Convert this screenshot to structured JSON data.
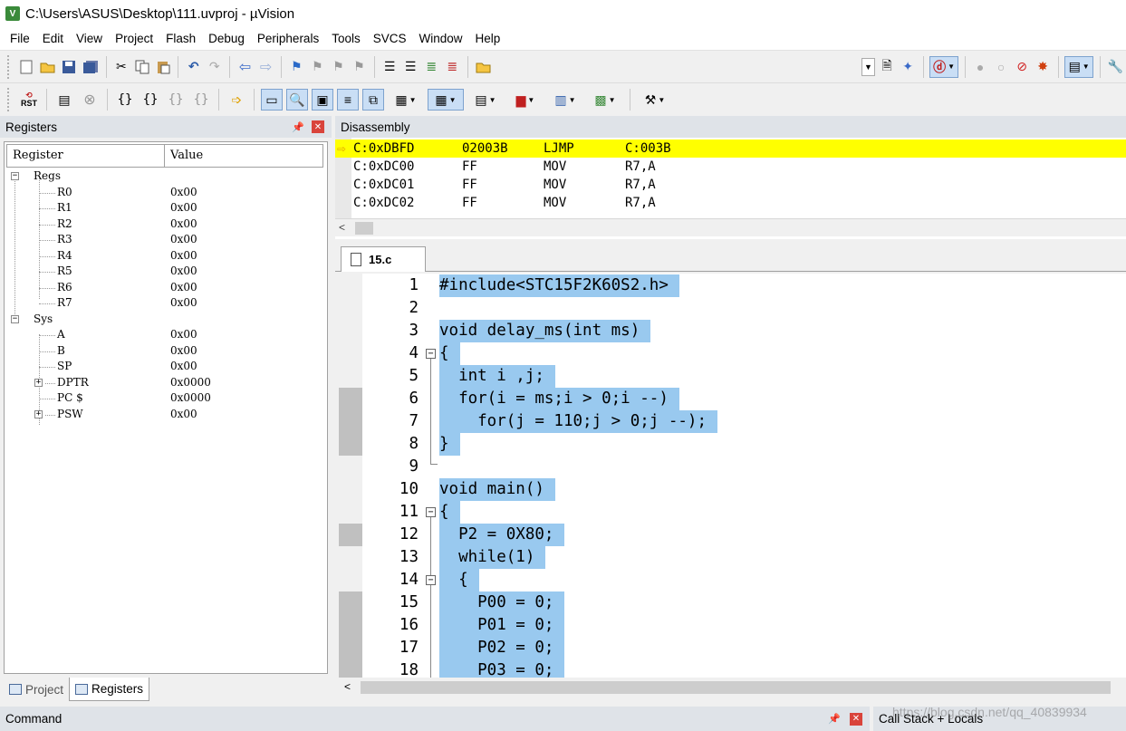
{
  "window": {
    "title": "C:\\Users\\ASUS\\Desktop\\111.uvproj - µVision",
    "icon": "uvision-app-icon"
  },
  "menu": [
    "File",
    "Edit",
    "View",
    "Project",
    "Flash",
    "Debug",
    "Peripherals",
    "Tools",
    "SVCS",
    "Window",
    "Help"
  ],
  "toolbar": {
    "reset_label": "RST"
  },
  "registers_panel": {
    "title": "Registers",
    "columns": [
      "Register",
      "Value"
    ],
    "rows": [
      {
        "name": "Regs",
        "value": ""
      },
      {
        "name": "R0",
        "value": "0x00"
      },
      {
        "name": "R1",
        "value": "0x00"
      },
      {
        "name": "R2",
        "value": "0x00"
      },
      {
        "name": "R3",
        "value": "0x00"
      },
      {
        "name": "R4",
        "value": "0x00"
      },
      {
        "name": "R5",
        "value": "0x00"
      },
      {
        "name": "R6",
        "value": "0x00"
      },
      {
        "name": "R7",
        "value": "0x00"
      },
      {
        "name": "Sys",
        "value": ""
      },
      {
        "name": "A",
        "value": "0x00"
      },
      {
        "name": "B",
        "value": "0x00"
      },
      {
        "name": "SP",
        "value": "0x00"
      },
      {
        "name": "DPTR",
        "value": "0x0000"
      },
      {
        "name": "PC $",
        "value": "0x0000"
      },
      {
        "name": "PSW",
        "value": "0x00"
      }
    ],
    "tabs": [
      "Project",
      "Registers"
    ]
  },
  "disassembly": {
    "title": "Disassembly",
    "lines": [
      {
        "addr": "C:0xDBFD",
        "opcode": "02003B",
        "mnemonic": "LJMP",
        "operand": "C:003B"
      },
      {
        "addr": "C:0xDC00",
        "opcode": "FF",
        "mnemonic": "MOV",
        "operand": "R7,A"
      },
      {
        "addr": "C:0xDC01",
        "opcode": "FF",
        "mnemonic": "MOV",
        "operand": "R7,A"
      },
      {
        "addr": "C:0xDC02",
        "opcode": "FF",
        "mnemonic": "MOV",
        "operand": "R7,A"
      }
    ]
  },
  "editor": {
    "tab": "15.c",
    "lines": [
      {
        "n": "1",
        "text": "#include<STC15F2K60S2.h>"
      },
      {
        "n": "2",
        "text": ""
      },
      {
        "n": "3",
        "text": "void delay_ms(int ms)"
      },
      {
        "n": "4",
        "text": "{"
      },
      {
        "n": "5",
        "text": "  int i ,j;"
      },
      {
        "n": "6",
        "text": "  for(i = ms;i > 0;i --)"
      },
      {
        "n": "7",
        "text": "    for(j = 110;j > 0;j --);"
      },
      {
        "n": "8",
        "text": "}"
      },
      {
        "n": "9",
        "text": ""
      },
      {
        "n": "10",
        "text": "void main()"
      },
      {
        "n": "11",
        "text": "{"
      },
      {
        "n": "12",
        "text": "  P2 = 0X80;"
      },
      {
        "n": "13",
        "text": "  while(1)"
      },
      {
        "n": "14",
        "text": "  {"
      },
      {
        "n": "15",
        "text": "    P00 = 0;"
      },
      {
        "n": "16",
        "text": "    P01 = 0;"
      },
      {
        "n": "17",
        "text": "    P02 = 0;"
      },
      {
        "n": "18",
        "text": "    P03 = 0;"
      }
    ]
  },
  "bottom": {
    "command_title": "Command",
    "callstack_title": "Call Stack + Locals"
  },
  "watermark": "https://blog.csdn.net/qq_40839934",
  "colors": {
    "current_line": "#ffff00",
    "selection": "#99c9ef",
    "close_button": "#d9443b"
  }
}
